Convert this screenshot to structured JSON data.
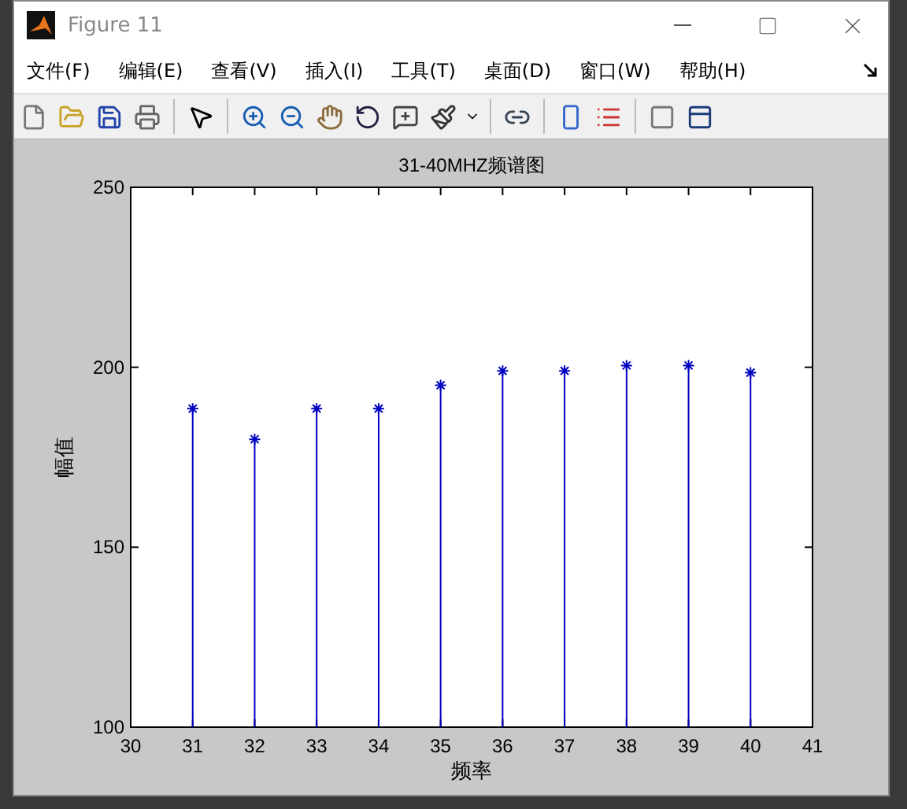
{
  "window": {
    "title": "Figure 11"
  },
  "menu": [
    "文件(F)",
    "编辑(E)",
    "查看(V)",
    "插入(I)",
    "工具(T)",
    "桌面(D)",
    "窗口(W)",
    "帮助(H)"
  ],
  "chart": {
    "chart_data": {
      "type": "bar",
      "title": "31-40MHZ频谱图",
      "xlabel": "频率",
      "ylabel": "幅值",
      "xlim": [
        30,
        41
      ],
      "ylim": [
        100,
        250
      ],
      "xticks": [
        30,
        31,
        32,
        33,
        34,
        35,
        36,
        37,
        38,
        39,
        40,
        41
      ],
      "yticks": [
        100,
        150,
        200,
        250
      ],
      "x": [
        31,
        32,
        33,
        34,
        35,
        36,
        37,
        38,
        39,
        40
      ],
      "series": [
        {
          "color": "#0000c0",
          "values": [
            188.5,
            180,
            188.5,
            188.5,
            195,
            199,
            199,
            200.5,
            200.5,
            198.5
          ]
        }
      ]
    }
  }
}
